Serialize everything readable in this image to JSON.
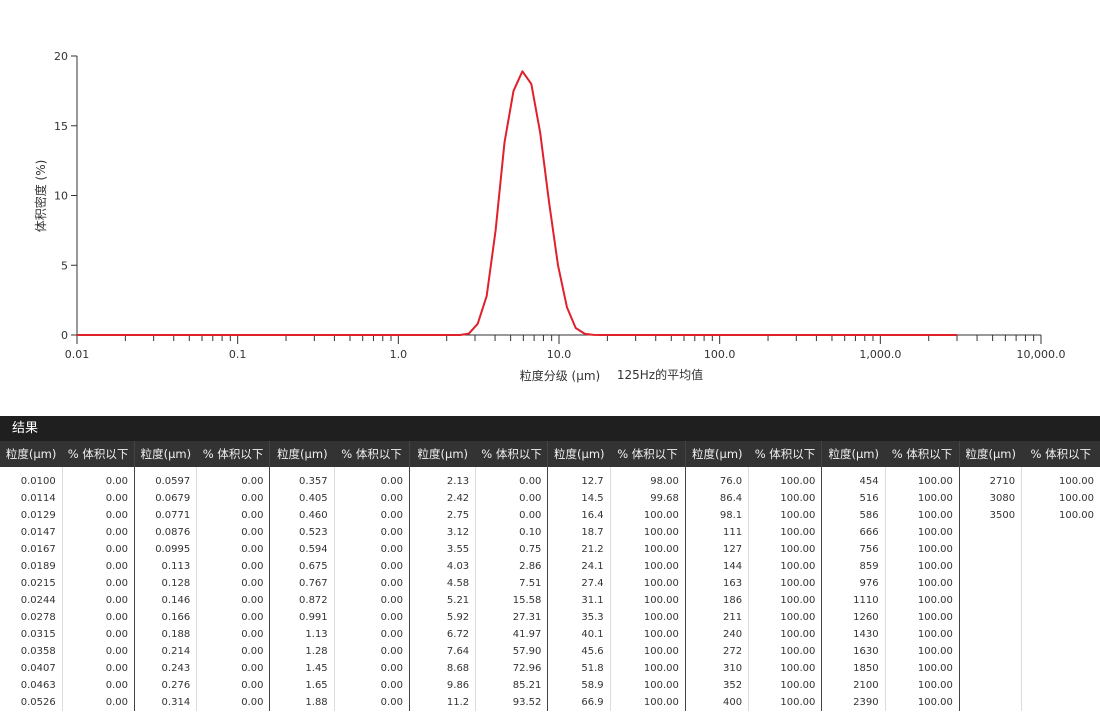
{
  "chart_data": {
    "type": "line",
    "xscale": "log",
    "xlim": [
      0.01,
      10000
    ],
    "ylim": [
      0,
      20
    ],
    "yticks": [
      0,
      5,
      10,
      15,
      20
    ],
    "xtick_labels": [
      {
        "x": 0.01,
        "label": "0.01"
      },
      {
        "x": 0.1,
        "label": "0.1"
      },
      {
        "x": 1,
        "label": "1.0"
      },
      {
        "x": 10,
        "label": "10.0"
      },
      {
        "x": 100,
        "label": "100.0"
      },
      {
        "x": 1000,
        "label": "1,000.0"
      },
      {
        "x": 10000,
        "label": "10,000.0"
      }
    ],
    "ylabel": "体积密度 (%)",
    "xlabel": "粒度分级 (μm)",
    "annotation": "125Hz的平均值",
    "line_color": "#e0202a",
    "series": [
      {
        "x": [
          0.01,
          0.1,
          1.0,
          2.42,
          2.75,
          3.12,
          3.55,
          4.03,
          4.58,
          5.21,
          5.92,
          6.72,
          7.64,
          8.68,
          9.86,
          11.2,
          12.7,
          14.5,
          16.4,
          18.7,
          21.2,
          100,
          1000,
          3000
        ],
        "y": [
          0,
          0,
          0,
          0,
          0.1,
          0.8,
          2.8,
          7.5,
          13.8,
          17.5,
          18.9,
          18.0,
          14.5,
          9.5,
          5.0,
          2.0,
          0.5,
          0.08,
          0.01,
          0,
          0,
          0,
          0,
          0
        ]
      }
    ]
  },
  "results": {
    "title": "结果",
    "col_size": "粒度(μm)",
    "col_pct": "% 体积以下",
    "groups": [
      {
        "size": [
          "0.0100",
          "0.0114",
          "0.0129",
          "0.0147",
          "0.0167",
          "0.0189",
          "0.0215",
          "0.0244",
          "0.0278",
          "0.0315",
          "0.0358",
          "0.0407",
          "0.0463",
          "0.0526"
        ],
        "pct": [
          "0.00",
          "0.00",
          "0.00",
          "0.00",
          "0.00",
          "0.00",
          "0.00",
          "0.00",
          "0.00",
          "0.00",
          "0.00",
          "0.00",
          "0.00",
          "0.00"
        ]
      },
      {
        "size": [
          "0.0597",
          "0.0679",
          "0.0771",
          "0.0876",
          "0.0995",
          "0.113",
          "0.128",
          "0.146",
          "0.166",
          "0.188",
          "0.214",
          "0.243",
          "0.276",
          "0.314"
        ],
        "pct": [
          "0.00",
          "0.00",
          "0.00",
          "0.00",
          "0.00",
          "0.00",
          "0.00",
          "0.00",
          "0.00",
          "0.00",
          "0.00",
          "0.00",
          "0.00",
          "0.00"
        ]
      },
      {
        "size": [
          "0.357",
          "0.405",
          "0.460",
          "0.523",
          "0.594",
          "0.675",
          "0.767",
          "0.872",
          "0.991",
          "1.13",
          "1.28",
          "1.45",
          "1.65",
          "1.88"
        ],
        "pct": [
          "0.00",
          "0.00",
          "0.00",
          "0.00",
          "0.00",
          "0.00",
          "0.00",
          "0.00",
          "0.00",
          "0.00",
          "0.00",
          "0.00",
          "0.00",
          "0.00"
        ]
      },
      {
        "size": [
          "2.13",
          "2.42",
          "2.75",
          "3.12",
          "3.55",
          "4.03",
          "4.58",
          "5.21",
          "5.92",
          "6.72",
          "7.64",
          "8.68",
          "9.86",
          "11.2"
        ],
        "pct": [
          "0.00",
          "0.00",
          "0.00",
          "0.10",
          "0.75",
          "2.86",
          "7.51",
          "15.58",
          "27.31",
          "41.97",
          "57.90",
          "72.96",
          "85.21",
          "93.52"
        ]
      },
      {
        "size": [
          "12.7",
          "14.5",
          "16.4",
          "18.7",
          "21.2",
          "24.1",
          "27.4",
          "31.1",
          "35.3",
          "40.1",
          "45.6",
          "51.8",
          "58.9",
          "66.9"
        ],
        "pct": [
          "98.00",
          "99.68",
          "100.00",
          "100.00",
          "100.00",
          "100.00",
          "100.00",
          "100.00",
          "100.00",
          "100.00",
          "100.00",
          "100.00",
          "100.00",
          "100.00"
        ]
      },
      {
        "size": [
          "76.0",
          "86.4",
          "98.1",
          "111",
          "127",
          "144",
          "163",
          "186",
          "211",
          "240",
          "272",
          "310",
          "352",
          "400"
        ],
        "pct": [
          "100.00",
          "100.00",
          "100.00",
          "100.00",
          "100.00",
          "100.00",
          "100.00",
          "100.00",
          "100.00",
          "100.00",
          "100.00",
          "100.00",
          "100.00",
          "100.00"
        ]
      },
      {
        "size": [
          "454",
          "516",
          "586",
          "666",
          "756",
          "859",
          "976",
          "1110",
          "1260",
          "1430",
          "1630",
          "1850",
          "2100",
          "2390"
        ],
        "pct": [
          "100.00",
          "100.00",
          "100.00",
          "100.00",
          "100.00",
          "100.00",
          "100.00",
          "100.00",
          "100.00",
          "100.00",
          "100.00",
          "100.00",
          "100.00",
          "100.00"
        ]
      },
      {
        "size": [
          "2710",
          "3080",
          "3500",
          "",
          "",
          "",
          "",
          "",
          "",
          "",
          "",
          "",
          "",
          ""
        ],
        "pct": [
          "100.00",
          "100.00",
          "100.00",
          "",
          "",
          "",
          "",
          "",
          "",
          "",
          "",
          "",
          "",
          ""
        ]
      }
    ]
  }
}
